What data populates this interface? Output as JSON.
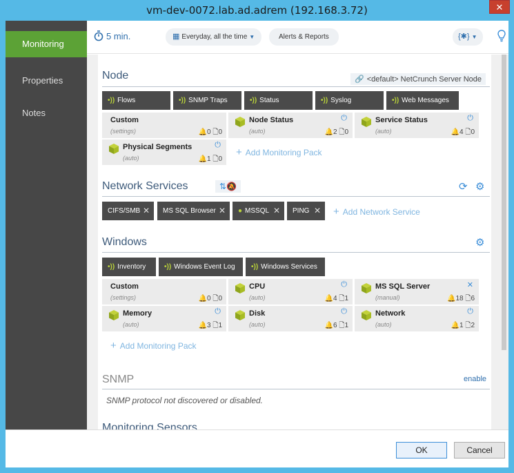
{
  "window": {
    "title": "vm-dev-0072.lab.ad.adrem (192.168.3.72)",
    "close_label": "✕"
  },
  "sidebar": {
    "items": [
      {
        "label": "Monitoring"
      },
      {
        "label": "Properties"
      },
      {
        "label": "Notes"
      }
    ]
  },
  "toolbar": {
    "interval": "5 min.",
    "schedule": "Everyday, all the time",
    "alerts": "Alerts & Reports",
    "code_label": "{✱}"
  },
  "node": {
    "title": "Node",
    "template_tag": "<default> NetCrunch Server Node",
    "chips": [
      "Flows",
      "SNMP Traps",
      "Status",
      "Syslog",
      "Web Messages"
    ],
    "cards": [
      {
        "name": "Custom",
        "sub": "(settings)",
        "alerts": "0",
        "sensors": "0"
      },
      {
        "name": "Node Status",
        "sub": "(auto)",
        "alerts": "2",
        "sensors": "0"
      },
      {
        "name": "Service Status",
        "sub": "(auto)",
        "alerts": "4",
        "sensors": "0"
      },
      {
        "name": "Physical Segments",
        "sub": "(auto)",
        "alerts": "1",
        "sensors": "0"
      }
    ],
    "add_pack": "Add Monitoring Pack"
  },
  "network_services": {
    "title": "Network Services",
    "services": [
      "CIFS/SMB",
      "MS SQL Browser",
      "MSSQL",
      "PING"
    ],
    "add_service": "Add Network Service"
  },
  "windows": {
    "title": "Windows",
    "chips": [
      "Inventory",
      "Windows Event Log",
      "Windows Services"
    ],
    "cards": [
      {
        "name": "Custom",
        "sub": "(settings)",
        "alerts": "0",
        "sensors": "0"
      },
      {
        "name": "CPU",
        "sub": "(auto)",
        "alerts": "4",
        "sensors": "1"
      },
      {
        "name": "MS SQL Server",
        "sub": "(manual)",
        "alerts": "18",
        "sensors": "6"
      },
      {
        "name": "Memory",
        "sub": "(auto)",
        "alerts": "3",
        "sensors": "1"
      },
      {
        "name": "Disk",
        "sub": "(auto)",
        "alerts": "6",
        "sensors": "1"
      },
      {
        "name": "Network",
        "sub": "(auto)",
        "alerts": "1",
        "sensors": "2"
      }
    ],
    "add_pack": "Add Monitoring Pack"
  },
  "snmp": {
    "title": "SNMP",
    "enable": "enable",
    "message": "SNMP protocol not discovered or disabled."
  },
  "sensors": {
    "title": "Monitoring Sensors"
  },
  "footer": {
    "ok": "OK",
    "cancel": "Cancel"
  },
  "colors": {
    "accent_green": "#5ca236",
    "title_bar": "#55b9e6",
    "link_blue": "#3a8dd8"
  }
}
